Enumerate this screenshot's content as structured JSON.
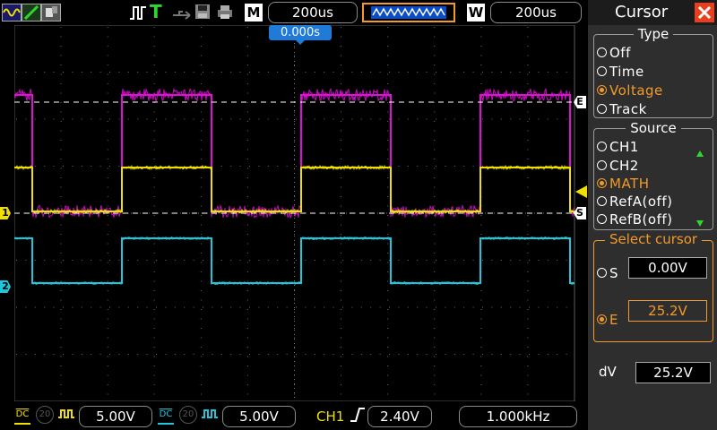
{
  "top": {
    "timebase_label": "M",
    "timebase": "200us",
    "window_label": "W",
    "window": "200us",
    "trigger_offset": "0.000s"
  },
  "markers": {
    "ch1": "1",
    "ch2": "2",
    "cursor_e": "E",
    "cursor_s": "S"
  },
  "bottom": {
    "ch1_coupling": "DC",
    "ch1_bw": "20",
    "ch1_scale": "5.00V",
    "ch2_coupling": "DC",
    "ch2_bw": "20",
    "ch2_scale": "5.00V",
    "trigger_source": "CH1",
    "trigger_level": "2.40V",
    "frequency": "1.000kHz"
  },
  "panel": {
    "title": "Cursor",
    "type_title": "Type",
    "type_options": [
      "Off",
      "Time",
      "Voltage",
      "Track"
    ],
    "type_selected": 2,
    "source_title": "Source",
    "source_options": [
      "CH1",
      "CH2",
      "MATH",
      "RefA(off)",
      "RefB(off)"
    ],
    "source_selected": 2,
    "select_title": "Select cursor",
    "s_label": "S",
    "s_value": "0.00V",
    "e_label": "E",
    "e_value": "25.2V",
    "dv_label": "dV",
    "dv_value": "25.2V"
  },
  "colors": {
    "ch1": "#f0e000",
    "ch2": "#1ec8dc",
    "math": "#e010d8",
    "accent": "#f39a2a",
    "close": "#e8401c"
  },
  "icons": [
    "ch1-wave-icon",
    "pencil-icon",
    "display-icon",
    "pulse-icon",
    "trigger-t-icon",
    "usb-icon",
    "save-icon",
    "print-icon",
    "close-icon"
  ]
}
